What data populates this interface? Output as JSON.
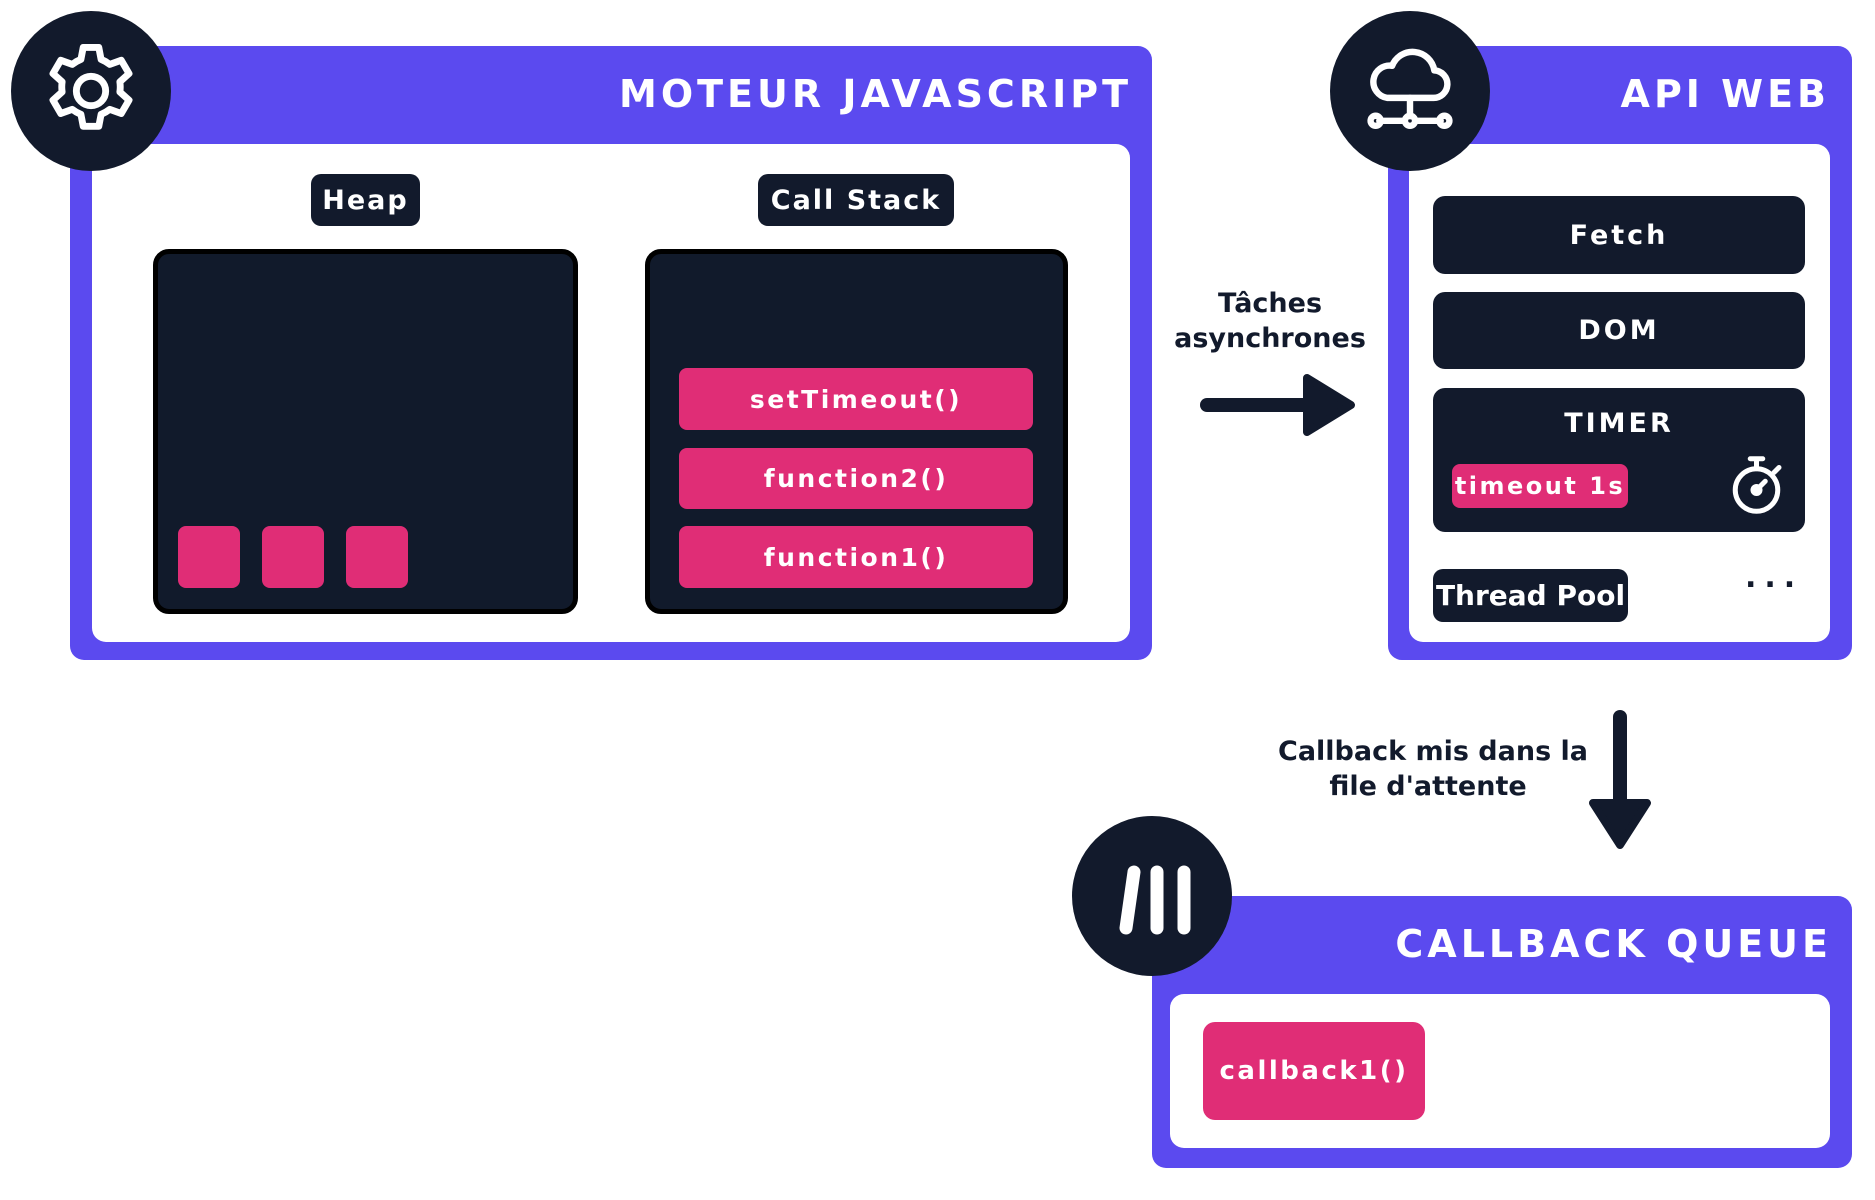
{
  "colors": {
    "panel": "#5b4aef",
    "dark": "#121a2c",
    "accent_pink": "#e02d76",
    "white": "#ffffff"
  },
  "js_engine": {
    "title": "MOTEUR JAVASCRIPT",
    "icon": "gear-icon",
    "heap": {
      "label": "Heap",
      "object_count": 3
    },
    "call_stack": {
      "label": "Call Stack",
      "frames": [
        "setTimeout()",
        "function2()",
        "function1()"
      ]
    }
  },
  "arrow_async": {
    "label_line1": "Tâches",
    "label_line2": "asynchrones"
  },
  "web_api": {
    "title": "API WEB",
    "icon": "cloud-network-icon",
    "items": [
      "Fetch",
      "DOM"
    ],
    "timer": {
      "label": "TIMER",
      "pill": "timeout 1s",
      "icon": "stopwatch-icon"
    },
    "thread_pool": "Thread Pool",
    "more": "..."
  },
  "arrow_callback": {
    "label_line1": "Callback mis dans la",
    "label_line2": "file d'attente"
  },
  "callback_queue": {
    "title": "CALLBACK QUEUE",
    "icon": "queue-bars-icon",
    "items": [
      "callback1()"
    ]
  }
}
